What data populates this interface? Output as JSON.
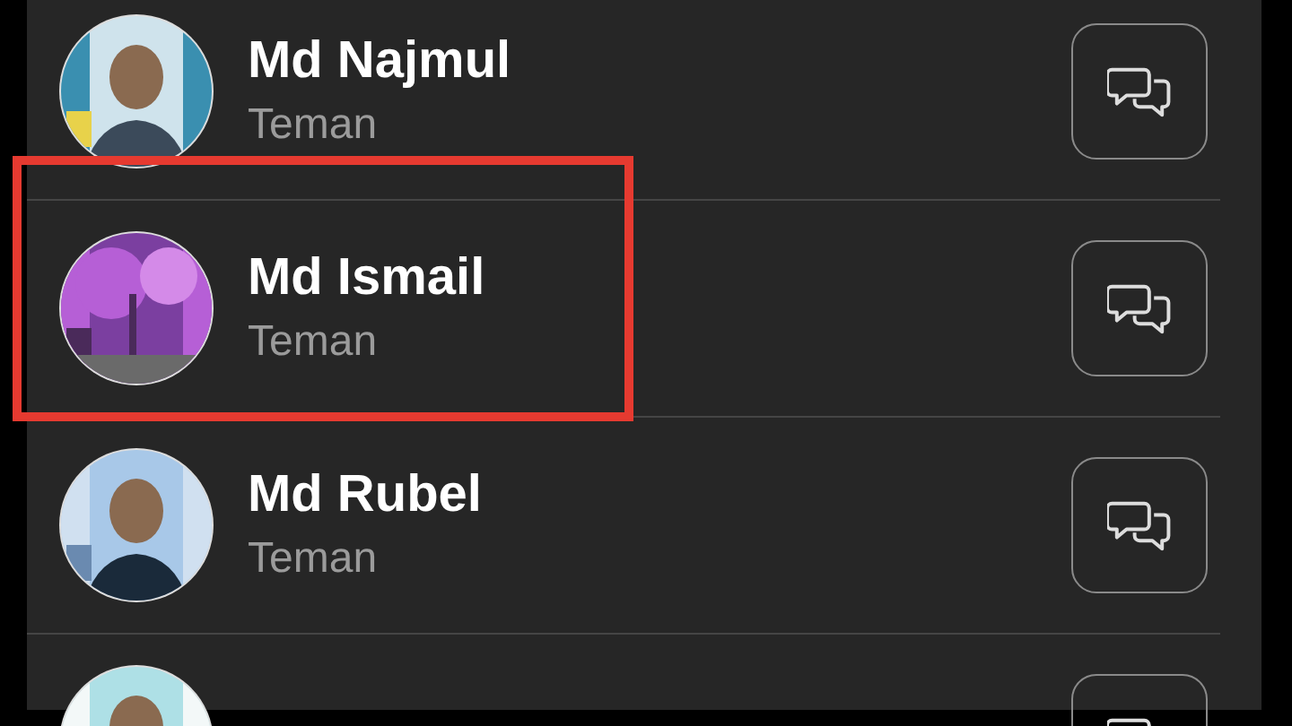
{
  "contacts": [
    {
      "name": "Md Najmul",
      "relation": "Teman",
      "highlighted": false
    },
    {
      "name": "Md Ismail",
      "relation": "Teman",
      "highlighted": true
    },
    {
      "name": "Md Rubel",
      "relation": "Teman",
      "highlighted": false
    },
    {
      "highlighted": false
    }
  ]
}
